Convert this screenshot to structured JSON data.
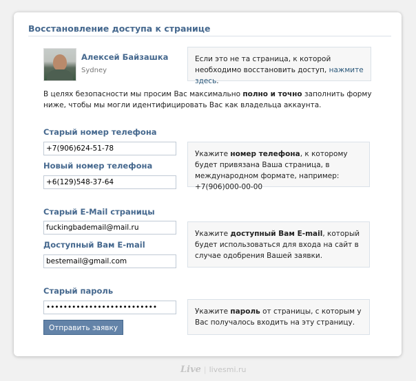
{
  "page": {
    "title": "Восстановление доступа к странице"
  },
  "user": {
    "name": "Алексей Байзашка",
    "city": "Sydney"
  },
  "wrong_page_hint": {
    "text": "Если это не та страница, к которой необходимо восстановить доступ, ",
    "link": "нажмите здесь",
    "tail": "."
  },
  "intro": {
    "before": "В целях безопасности мы просим Вас максимально ",
    "bold": "полно и точно",
    "after": " заполнить форму ниже, чтобы мы могли идентифицировать Вас как владельца аккаунта."
  },
  "phone_section": {
    "old_label": "Старый номер телефона",
    "old_value": "+7(906)624-51-78",
    "new_label": "Новый номер телефона",
    "new_value": "+6(129)548-37-64",
    "hint_before": "Укажите ",
    "hint_bold": "номер телефона",
    "hint_after": ", к которому будет привязана Ваша страница, в международном формате, например: +7(906)000-00-00"
  },
  "email_section": {
    "old_label": "Старый E-Mail страницы",
    "old_value": "fuckingbademail@mail.ru",
    "new_label": "Доступный Вам E-mail",
    "new_value": "bestemail@gmail.com",
    "hint_before": "Укажите ",
    "hint_bold": "доступный Вам E-mail",
    "hint_after": ", который будет использоваться для входа на сайт в случае одобрения Вашей заявки."
  },
  "password_section": {
    "label": "Старый пароль",
    "value": "••••••••••••••••••••••••••",
    "hint_before": "Укажите ",
    "hint_bold": "пароль",
    "hint_after": " от страницы, с которым у Вас получалось входить на эту страницу."
  },
  "submit_label": "Отправить заявку",
  "watermark": {
    "logo": "Live",
    "site": "livesmi.ru"
  },
  "colors": {
    "heading_blue": "#45688e",
    "button_blue": "#6383a8",
    "hint_background": "#f7f7f7"
  },
  "icons": [
    "user-avatar-photo"
  ]
}
